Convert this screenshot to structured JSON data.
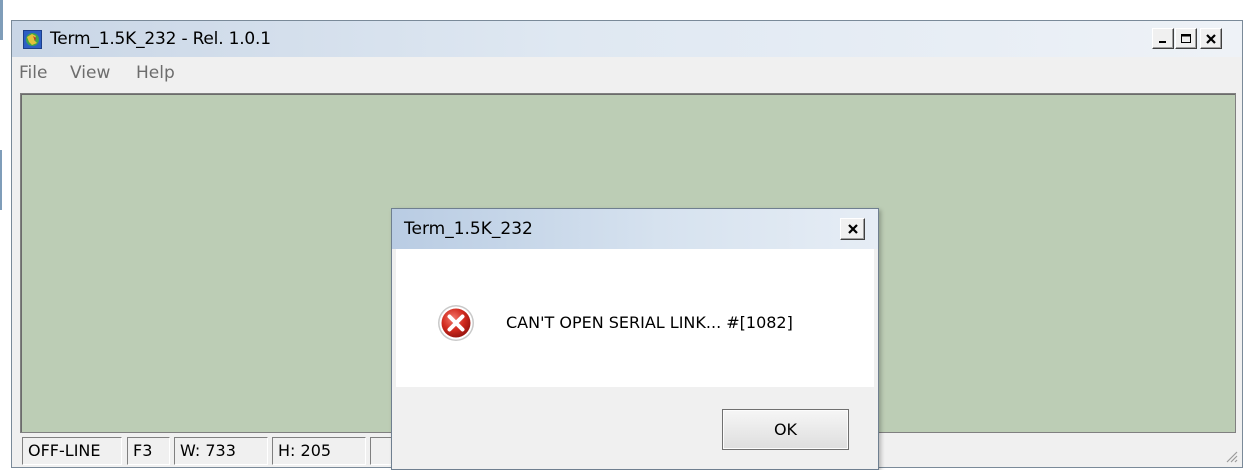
{
  "window": {
    "title": "Term_1.5K_232 - Rel. 1.0.1",
    "icon": "app-globe-icon"
  },
  "menu": {
    "items": [
      "File",
      "View",
      "Help"
    ]
  },
  "colors": {
    "client_area": "#bccdb5",
    "titlebar": "#c9d6e6"
  },
  "statusbar": {
    "panels": [
      "OFF-LINE",
      "F3",
      "W: 733",
      "H: 205",
      ""
    ]
  },
  "dialog": {
    "title": "Term_1.5K_232",
    "icon": "error-icon",
    "message": "CAN'T OPEN SERIAL LINK... #[1082]",
    "ok_label": "OK"
  }
}
